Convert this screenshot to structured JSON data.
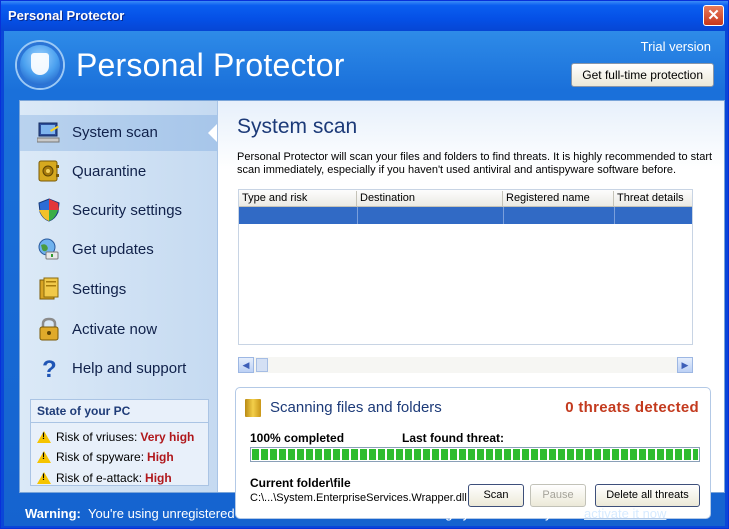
{
  "window": {
    "title": "Personal Protector",
    "close_glyph": "✕"
  },
  "header": {
    "app_name": "Personal Protector",
    "trial_label": "Trial version",
    "upgrade_button": "Get full-time protection",
    "logo_icon": "shield-logo-icon"
  },
  "sidebar": {
    "items": [
      {
        "label": "System scan",
        "icon": "monitor-scan-icon",
        "active": true
      },
      {
        "label": "Quarantine",
        "icon": "safe-icon",
        "active": false
      },
      {
        "label": "Security settings",
        "icon": "security-shield-icon",
        "active": false
      },
      {
        "label": "Get updates",
        "icon": "globe-update-icon",
        "active": false
      },
      {
        "label": "Settings",
        "icon": "settings-folder-icon",
        "active": false
      },
      {
        "label": "Activate now",
        "icon": "lock-icon",
        "active": false
      },
      {
        "label": "Help and support",
        "icon": "question-icon",
        "active": false
      }
    ],
    "state": {
      "title": "State of your PC",
      "risks": [
        {
          "label": "Risk of vriuses:",
          "value": "Very high"
        },
        {
          "label": "Risk of spyware:",
          "value": "High"
        },
        {
          "label": "Risk of e-attack:",
          "value": "High"
        }
      ]
    }
  },
  "main": {
    "title": "System scan",
    "description": "Personal Protector will scan your files and folders to find threats. It is highly recommended to start scan immediately, especially if you haven't used antiviral and antispyware software before.",
    "table": {
      "columns": [
        "Type and risk",
        "Destination",
        "Registered name",
        "Threat details"
      ]
    },
    "scan": {
      "title": "Scanning files and folders",
      "threats": "0 threats detected",
      "progress_label": "100% completed",
      "progress": 1.0,
      "last_found_label": "Last found threat:",
      "current_folder_label": "Current folder\\file",
      "current_path": "C:\\...\\System.EnterpriseServices.Wrapper.dll",
      "scan_button": "Scan",
      "pause_button": "Pause",
      "delete_button": "Delete all threats"
    }
  },
  "warning": {
    "label": "Warning:",
    "text": "You're using unregistered version of Personal Protector. We highly recommend you to",
    "link": "activate it now"
  },
  "colors": {
    "titlebar": "#0550e6",
    "threat_red": "#c33a1e",
    "risk_red": "#b0181c",
    "progress_green": "#2ebc2e",
    "selection_blue": "#316ac5"
  }
}
